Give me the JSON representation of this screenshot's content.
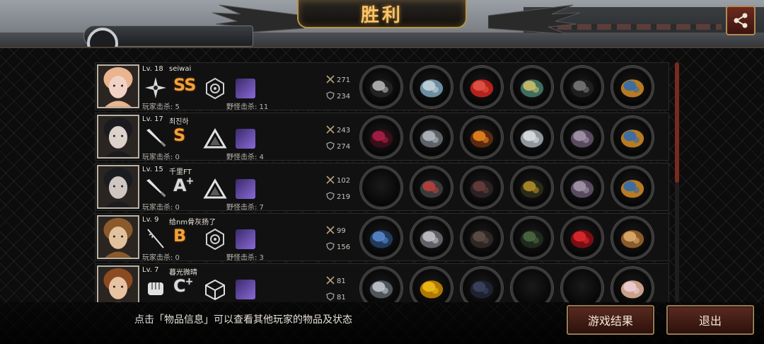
{
  "header": {
    "title": "胜利"
  },
  "players": [
    {
      "level": "Lv. 18",
      "name": "seiwai",
      "rank": "SS",
      "rank_sup": "",
      "weapon_icon": "shuriken-icon",
      "class_icon": "gear-ring-icon",
      "pvp_kills": "玩家击杀: 5",
      "pve_kills": "野怪击杀: 11",
      "attack": "271",
      "defense": "234",
      "avatar_palette": [
        "#f1d3c5",
        "#e9b48f"
      ],
      "gear": [
        "scythe",
        "mask",
        "red-jacket",
        "belt",
        "boots",
        "goggles"
      ]
    },
    {
      "level": "Lv. 17",
      "name": "최진하",
      "rank": "S",
      "rank_sup": "",
      "weapon_icon": "knife-icon",
      "class_icon": "triangle-icon",
      "pvp_kills": "玩家击杀: 0",
      "pve_kills": "野怪击杀: 4",
      "attack": "243",
      "defense": "274",
      "avatar_palette": [
        "#dcd2cb",
        "#1b1b1f"
      ],
      "gear": [
        "dark-blade",
        "helmet",
        "fire-armor",
        "feather-arm",
        "purple-boots",
        "goggles"
      ]
    },
    {
      "level": "Lv. 15",
      "name": "千里FT",
      "rank": "A",
      "rank_sup": "+",
      "weapon_icon": "knife-icon",
      "class_icon": "triangle-icon",
      "pvp_kills": "玩家击杀: 0",
      "pve_kills": "野怪击杀: 7",
      "attack": "102",
      "defense": "219",
      "avatar_palette": [
        "#cfc6c2",
        "#1b1c22"
      ],
      "gear": [
        "empty",
        "visor",
        "dark-armor",
        "vine-bracelet",
        "purple-boots",
        "goggles"
      ]
    },
    {
      "level": "Lv. 9",
      "name": "给nm骨灰扬了",
      "rank": "B",
      "rank_sup": "",
      "weapon_icon": "rapier-icon",
      "class_icon": "gear-ring-icon",
      "pvp_kills": "玩家击杀: 0",
      "pve_kills": "野怪击杀: 3",
      "attack": "99",
      "defense": "156",
      "avatar_palette": [
        "#e2c29e",
        "#8b5a2b"
      ],
      "gear": [
        "blue-spear",
        "knight-helm",
        "leather-vest",
        "green-stick",
        "red-heels",
        "fan"
      ]
    },
    {
      "level": "Lv. 7",
      "name": "暮光微晴",
      "rank": "C",
      "rank_sup": "+",
      "weapon_icon": "fist-icon",
      "class_icon": "cube-icon",
      "pvp_kills": "",
      "pve_kills": "",
      "attack": "81",
      "defense": "81",
      "avatar_palette": [
        "#e7c3a2",
        "#8a4a22"
      ],
      "gear": [
        "gauntlet",
        "hard-hat",
        "suit",
        "empty",
        "empty",
        "doll"
      ]
    }
  ],
  "footer": {
    "hint": "点击「物品信息」可以查看其他玩家的物品及状态",
    "result_label": "游戏结果",
    "exit_label": "退出"
  },
  "colors": {
    "accent_gold": "#f6c46a",
    "rank_orange": "#f0a23b",
    "button_red": "#5a2a20"
  }
}
